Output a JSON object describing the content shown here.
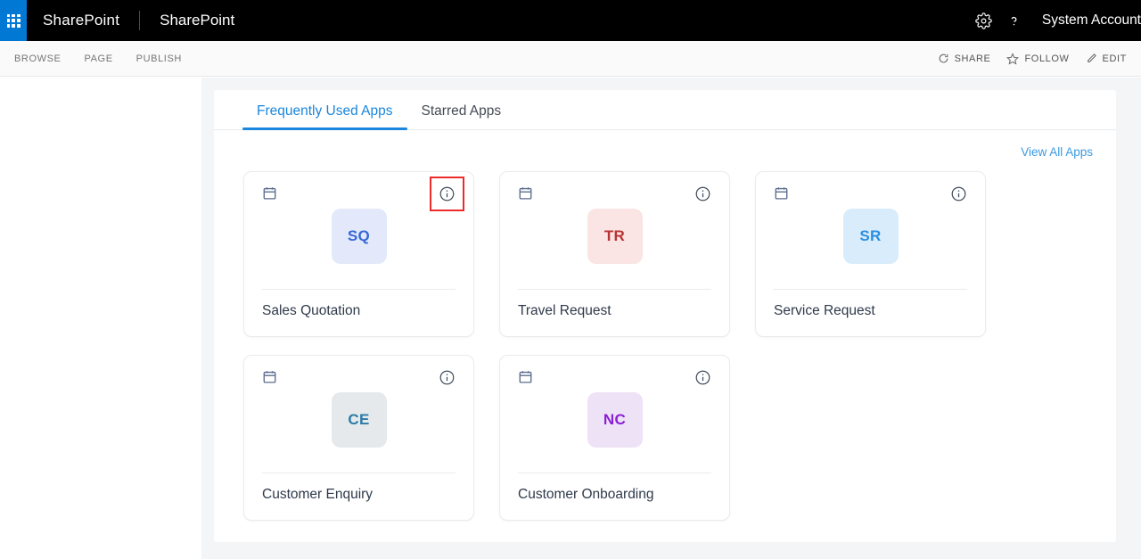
{
  "suitebar": {
    "waffle_label": "App launcher",
    "brand": "SharePoint",
    "site_name": "SharePoint",
    "settings_icon": "gear-icon",
    "help_icon": "help-icon",
    "user_name": "System Account"
  },
  "ribbon": {
    "tabs": [
      {
        "label": "BROWSE"
      },
      {
        "label": "PAGE"
      },
      {
        "label": "PUBLISH"
      }
    ],
    "actions": [
      {
        "label": "SHARE",
        "icon": "share-icon"
      },
      {
        "label": "FOLLOW",
        "icon": "star-icon"
      },
      {
        "label": "EDIT",
        "icon": "pencil-icon"
      }
    ]
  },
  "panel": {
    "tabs": [
      {
        "label": "Frequently Used Apps",
        "active": true
      },
      {
        "label": "Starred Apps",
        "active": false
      }
    ],
    "view_all_label": "View All Apps",
    "cards": [
      {
        "title": "Sales Quotation",
        "initials": "SQ",
        "avatar_bg": "#e3e9fa",
        "avatar_fg": "#3767d6",
        "type_icon": "calendar-icon",
        "info_icon": "info-icon",
        "highlighted": true
      },
      {
        "title": "Travel Request",
        "initials": "TR",
        "avatar_bg": "#fae4e4",
        "avatar_fg": "#b93434",
        "type_icon": "calendar-icon",
        "info_icon": "info-icon",
        "highlighted": false
      },
      {
        "title": "Service Request",
        "initials": "SR",
        "avatar_bg": "#d8ecfb",
        "avatar_fg": "#2a8fe0",
        "type_icon": "calendar-icon",
        "info_icon": "info-icon",
        "highlighted": false
      },
      {
        "title": "Customer Enquiry",
        "initials": "CE",
        "avatar_bg": "#e5e9ec",
        "avatar_fg": "#2b7ba8",
        "type_icon": "calendar-icon",
        "info_icon": "info-icon",
        "highlighted": false
      },
      {
        "title": "Customer Onboarding",
        "initials": "NC",
        "avatar_bg": "#eee2f7",
        "avatar_fg": "#8b1fd6",
        "type_icon": "calendar-icon",
        "info_icon": "info-icon",
        "highlighted": false
      }
    ]
  },
  "colors": {
    "suitebar_bg": "#000000",
    "waffle_bg": "#0078d4",
    "accent_blue": "#1a86dd",
    "link_blue": "#3b9ae1",
    "highlight_red": "#ee2b2b",
    "page_bg": "#f4f5f7"
  }
}
